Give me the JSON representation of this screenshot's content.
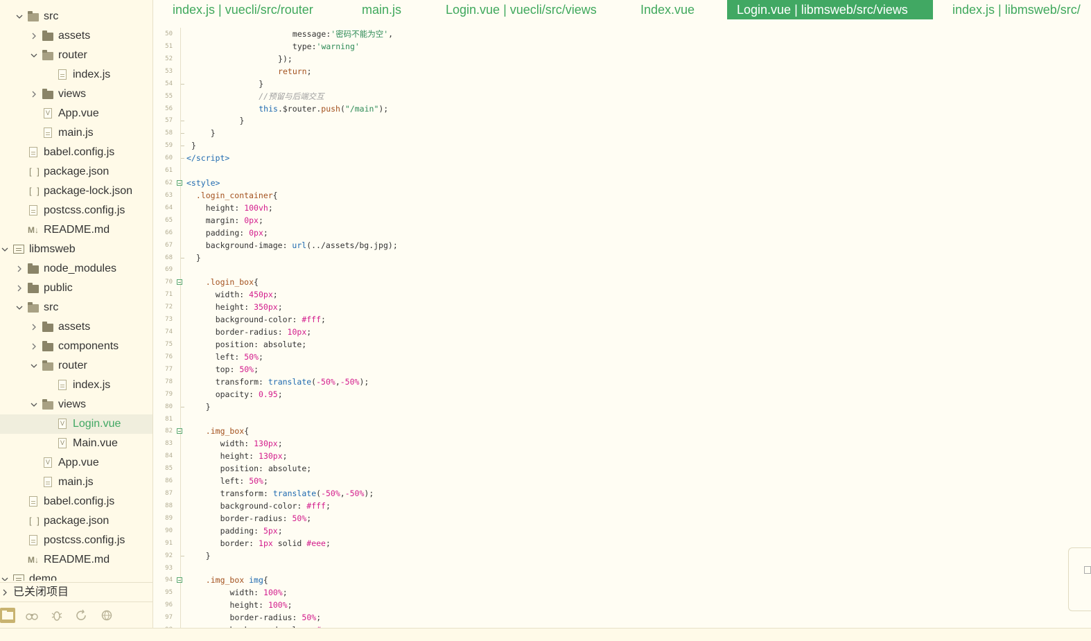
{
  "tabs": [
    {
      "label": "index.js | vuecli/src/router",
      "active": false
    },
    {
      "label": "main.js",
      "active": false
    },
    {
      "label": "Login.vue | vuecli/src/views",
      "active": false
    },
    {
      "label": "Index.vue",
      "active": false
    },
    {
      "label": "Login.vue | libmsweb/src/views",
      "active": true
    },
    {
      "label": "index.js | libmsweb/src/"
    }
  ],
  "tree": [
    {
      "label": "src",
      "type": "folder",
      "depth": 1,
      "expanded": true
    },
    {
      "label": "assets",
      "type": "folder",
      "depth": 2,
      "expanded": false
    },
    {
      "label": "router",
      "type": "folder",
      "depth": 2,
      "expanded": true
    },
    {
      "label": "index.js",
      "type": "file",
      "depth": 3
    },
    {
      "label": "views",
      "type": "folder",
      "depth": 2,
      "expanded": false
    },
    {
      "label": "App.vue",
      "type": "vue",
      "depth": 2
    },
    {
      "label": "main.js",
      "type": "file",
      "depth": 2
    },
    {
      "label": "babel.config.js",
      "type": "file",
      "depth": 1
    },
    {
      "label": "package.json",
      "type": "json",
      "depth": 1
    },
    {
      "label": "package-lock.json",
      "type": "json",
      "depth": 1
    },
    {
      "label": "postcss.config.js",
      "type": "file",
      "depth": 1
    },
    {
      "label": "README.md",
      "type": "md",
      "depth": 1
    },
    {
      "label": "libmsweb",
      "type": "project",
      "depth": 0,
      "expanded": true
    },
    {
      "label": "node_modules",
      "type": "folder",
      "depth": 1,
      "expanded": false
    },
    {
      "label": "public",
      "type": "folder",
      "depth": 1,
      "expanded": false
    },
    {
      "label": "src",
      "type": "folder",
      "depth": 1,
      "expanded": true
    },
    {
      "label": "assets",
      "type": "folder",
      "depth": 2,
      "expanded": false
    },
    {
      "label": "components",
      "type": "folder",
      "depth": 2,
      "expanded": false
    },
    {
      "label": "router",
      "type": "folder",
      "depth": 2,
      "expanded": true
    },
    {
      "label": "index.js",
      "type": "file",
      "depth": 3
    },
    {
      "label": "views",
      "type": "folder",
      "depth": 2,
      "expanded": true
    },
    {
      "label": "Login.vue",
      "type": "vue",
      "depth": 3,
      "selected": true
    },
    {
      "label": "Main.vue",
      "type": "vue",
      "depth": 3
    },
    {
      "label": "App.vue",
      "type": "vue",
      "depth": 2
    },
    {
      "label": "main.js",
      "type": "file",
      "depth": 2
    },
    {
      "label": "babel.config.js",
      "type": "file",
      "depth": 1
    },
    {
      "label": "package.json",
      "type": "json",
      "depth": 1
    },
    {
      "label": "postcss.config.js",
      "type": "file",
      "depth": 1
    },
    {
      "label": "README.md",
      "type": "md",
      "depth": 1
    },
    {
      "label": "demo",
      "type": "project",
      "depth": 0,
      "expanded": true
    }
  ],
  "closed_projects_label": "已关闭项目",
  "bottom_icons": [
    "project-manager-icon",
    "search-binoculars-icon",
    "debug-bug-icon",
    "refresh-icon",
    "browser-icon"
  ],
  "editor": {
    "lines": [
      {
        "n": "50",
        "indent": 22,
        "html": "message:<span class='t-str'>'密码不能为空'</span>,"
      },
      {
        "n": "51",
        "indent": 22,
        "html": "type:<span class='t-str'>'warning'</span>"
      },
      {
        "n": "52",
        "indent": 19,
        "html": "});"
      },
      {
        "n": "53",
        "indent": 19,
        "html": "<span class='t-kw'>return</span>;"
      },
      {
        "n": "54",
        "indent": 15,
        "html": "}",
        "dash": true
      },
      {
        "n": "55",
        "indent": 15,
        "html": "<span class='t-com'>//预留与后端交互</span>"
      },
      {
        "n": "56",
        "indent": 15,
        "html": "<span class='t-this'>this</span>.$router.<span class='t-kw'>push</span>(<span class='t-str'>\"/main\"</span>);"
      },
      {
        "n": "57",
        "indent": 11,
        "html": "}",
        "dash": true
      },
      {
        "n": "58",
        "indent": 5,
        "html": "}",
        "dash": true
      },
      {
        "n": "59",
        "indent": 1,
        "html": "}",
        "dash": true
      },
      {
        "n": "60",
        "indent": 0,
        "html": "<span class='t-tag'>&lt;/script&gt;</span>",
        "dash": true
      },
      {
        "n": "61",
        "indent": 0,
        "html": ""
      },
      {
        "n": "62",
        "indent": 0,
        "html": "<span class='t-tag'>&lt;style&gt;</span>",
        "fold": true
      },
      {
        "n": "63",
        "indent": 2,
        "html": "<span class='t-sel'>.login_container</span>{"
      },
      {
        "n": "64",
        "indent": 4,
        "html": "height: <span class='t-num'>100vh</span>;"
      },
      {
        "n": "65",
        "indent": 4,
        "html": "margin: <span class='t-num'>0px</span>;"
      },
      {
        "n": "66",
        "indent": 4,
        "html": "padding: <span class='t-num'>0px</span>;"
      },
      {
        "n": "67",
        "indent": 4,
        "html": "background-image: <span class='t-func'>url</span>(../assets/bg.jpg);"
      },
      {
        "n": "68",
        "indent": 2,
        "html": "}",
        "dash": true
      },
      {
        "n": "69",
        "indent": 0,
        "html": ""
      },
      {
        "n": "70",
        "indent": 4,
        "html": "<span class='t-sel'>.login_box</span>{",
        "fold": true
      },
      {
        "n": "71",
        "indent": 6,
        "html": "width: <span class='t-num'>450px</span>;"
      },
      {
        "n": "72",
        "indent": 6,
        "html": "height: <span class='t-num'>350px</span>;"
      },
      {
        "n": "73",
        "indent": 6,
        "html": "background-color: <span class='t-num'>#fff</span>;"
      },
      {
        "n": "74",
        "indent": 6,
        "html": "border-radius: <span class='t-num'>10px</span>;"
      },
      {
        "n": "75",
        "indent": 6,
        "html": "position: absolute;"
      },
      {
        "n": "76",
        "indent": 6,
        "html": "left: <span class='t-num'>50%</span>;"
      },
      {
        "n": "77",
        "indent": 6,
        "html": "top: <span class='t-num'>50%</span>;"
      },
      {
        "n": "78",
        "indent": 6,
        "html": "transform: <span class='t-func'>translate</span>(<span class='t-num'>-50%</span>,<span class='t-num'>-50%</span>);"
      },
      {
        "n": "79",
        "indent": 6,
        "html": "opacity: <span class='t-num'>0.95</span>;"
      },
      {
        "n": "80",
        "indent": 4,
        "html": "}",
        "dash": true
      },
      {
        "n": "81",
        "indent": 0,
        "html": ""
      },
      {
        "n": "82",
        "indent": 4,
        "html": "<span class='t-sel'>.img_box</span>{",
        "fold": true
      },
      {
        "n": "83",
        "indent": 7,
        "html": "width: <span class='t-num'>130px</span>;"
      },
      {
        "n": "84",
        "indent": 7,
        "html": "height: <span class='t-num'>130px</span>;"
      },
      {
        "n": "85",
        "indent": 7,
        "html": "position: absolute;"
      },
      {
        "n": "86",
        "indent": 7,
        "html": "left: <span class='t-num'>50%</span>;"
      },
      {
        "n": "87",
        "indent": 7,
        "html": "transform: <span class='t-func'>translate</span>(<span class='t-num'>-50%</span>,<span class='t-num'>-50%</span>);"
      },
      {
        "n": "88",
        "indent": 7,
        "html": "background-color: <span class='t-num'>#fff</span>;"
      },
      {
        "n": "89",
        "indent": 7,
        "html": "border-radius: <span class='t-num'>50%</span>;"
      },
      {
        "n": "90",
        "indent": 7,
        "html": "padding: <span class='t-num'>5px</span>;"
      },
      {
        "n": "91",
        "indent": 7,
        "html": "border: <span class='t-num'>1px</span> solid <span class='t-num'>#eee</span>;"
      },
      {
        "n": "92",
        "indent": 4,
        "html": "}",
        "dash": true
      },
      {
        "n": "93",
        "indent": 0,
        "html": ""
      },
      {
        "n": "94",
        "indent": 4,
        "html": "<span class='t-sel'>.img_box</span> <span class='t-tag'>img</span>{",
        "fold": true
      },
      {
        "n": "95",
        "indent": 9,
        "html": "width: <span class='t-num'>100%</span>;"
      },
      {
        "n": "96",
        "indent": 9,
        "html": "height: <span class='t-num'>100%</span>;"
      },
      {
        "n": "97",
        "indent": 9,
        "html": "border-radius: <span class='t-num'>50%</span>;"
      },
      {
        "n": "98",
        "indent": 9,
        "html": "background-color: <span class='t-num'>#eee</span>;"
      }
    ]
  },
  "colors": {
    "accent": "#41a863",
    "sidebar_bg": "#fffae8",
    "editor_bg": "#fffdf3"
  }
}
